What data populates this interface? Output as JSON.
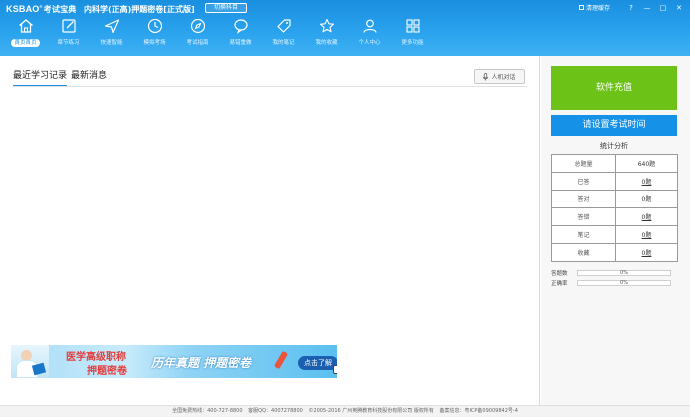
{
  "header": {
    "logo_main": "KSBAO",
    "logo_mark": "®",
    "logo_sub": "考试宝典",
    "app_title": "内科学(正高)押题密卷[正式版]",
    "switch_label": "切换科目",
    "clear_cache_label": "清理缓存",
    "window_buttons": [
      "?",
      "—",
      "□",
      "✕"
    ]
  },
  "nav": [
    {
      "label": "首页首页",
      "icon": "home-icon"
    },
    {
      "label": "章节练习",
      "icon": "edit-icon"
    },
    {
      "label": "快速智能",
      "icon": "paper-plane-icon"
    },
    {
      "label": "模拟考场",
      "icon": "clock-icon"
    },
    {
      "label": "考试指南",
      "icon": "compass-icon"
    },
    {
      "label": "易错重做",
      "icon": "chat-bubble-icon"
    },
    {
      "label": "我的笔记",
      "icon": "tag-icon"
    },
    {
      "label": "我的收藏",
      "icon": "star-icon"
    },
    {
      "label": "个人中心",
      "icon": "user-icon"
    },
    {
      "label": "更多功能",
      "icon": "grid-icon"
    }
  ],
  "main": {
    "tabs": [
      "最近学习记录",
      "最新消息"
    ],
    "ai_button": "人机对话",
    "banner": {
      "line1": "医学高级职称",
      "line2": "押题密卷",
      "slogan": "历年真题  押题密卷",
      "cta": "点击了解"
    }
  },
  "sidebar": {
    "recharge_label": "软件充值",
    "exam_time_label": "请设置考试时间",
    "stats_title": "统计分析",
    "stats": [
      {
        "label": "总题量",
        "value": "640题"
      },
      {
        "label": "已答",
        "value": "0题"
      },
      {
        "label": "答对",
        "value": "0题"
      },
      {
        "label": "答错",
        "value": "0题"
      },
      {
        "label": "笔记",
        "value": "0题"
      },
      {
        "label": "收藏",
        "value": "0题"
      }
    ],
    "progress": [
      {
        "label": "答题数",
        "percent_text": "0%",
        "fraction": 0
      },
      {
        "label": "正确率",
        "percent_text": "0%",
        "fraction": 0
      }
    ]
  },
  "footer": {
    "hotline": "全国免费热线：400-727-8800",
    "qq": "客服QQ：4007278800",
    "copyright": "©2005-2016 广州英腾教育科技股份有限公司 版权所有",
    "icp": "备案信息：粤ICP备09009842号-4"
  },
  "colors": {
    "header_blue": "#1a8fe0",
    "recharge_green": "#6cc217",
    "exam_blue": "#1591e8"
  }
}
